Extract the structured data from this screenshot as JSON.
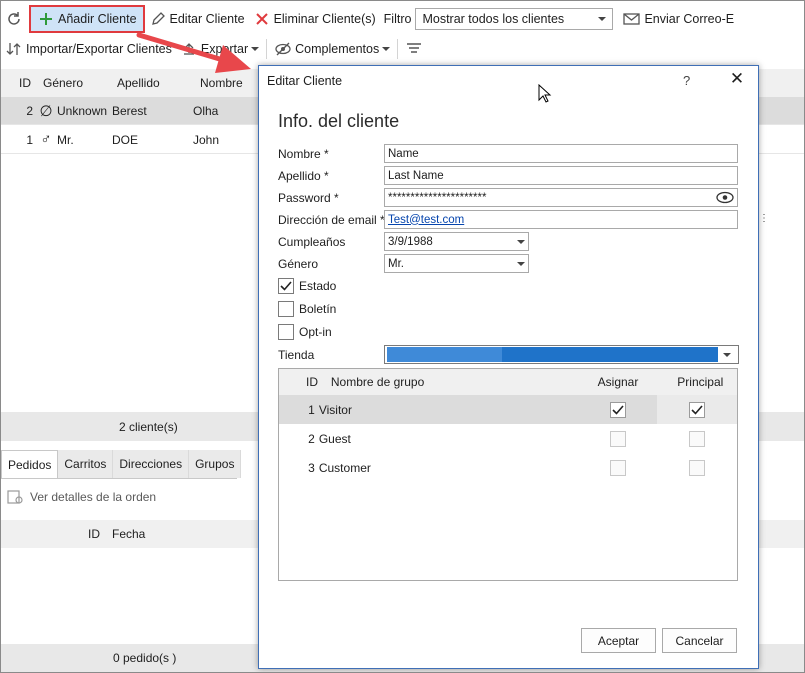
{
  "toolbar1": {
    "add_label": "Añadir Cliente",
    "edit_label": "Editar Cliente",
    "delete_label": "Eliminar Cliente(s)",
    "filter_label": "Filtro",
    "filter_value": "Mostrar todos los clientes",
    "email_label": "Enviar Correo-E"
  },
  "toolbar2": {
    "import_label": "Importar/Exportar Clientes",
    "export_label": "Exportar",
    "addons_label": "Complementos"
  },
  "customers_grid": {
    "columns": [
      "ID",
      "Género",
      "Apellido",
      "Nombre"
    ],
    "rows": [
      {
        "id": "2",
        "gender": "Unknown",
        "last": "Berest",
        "first": "Olha"
      },
      {
        "id": "1",
        "gender": "Mr.",
        "last": "DOE",
        "first": "John"
      }
    ],
    "status": "2 cliente(s)"
  },
  "subtabs": [
    "Pedidos",
    "Carritos",
    "Direcciones",
    "Grupos"
  ],
  "orders": {
    "details_label": "Ver detalles de la orden",
    "columns": [
      "ID",
      "Fecha"
    ],
    "status": "0 pedido(s )"
  },
  "dialog": {
    "title": "Editar Cliente",
    "help": "?",
    "close": "✕",
    "heading": "Info. del cliente",
    "labels": {
      "first_name": "Nombre *",
      "last_name": "Apellido *",
      "password": "Password *",
      "email": "Dirección de email *",
      "birthday": "Cumpleaños",
      "gender": "Género",
      "status": "Estado",
      "newsletter": "Boletín",
      "optin": "Opt-in",
      "shop": "Tienda"
    },
    "values": {
      "first_name": "Name",
      "last_name": "Last Name",
      "password": "**********************",
      "email": "Test@test.com",
      "birthday": "3/9/1988",
      "gender": "Mr."
    },
    "checks": {
      "status": true,
      "newsletter": false,
      "optin": false
    },
    "groups": {
      "columns": [
        "ID",
        "Nombre de grupo",
        "Asignar",
        "Principal"
      ],
      "rows": [
        {
          "id": "1",
          "name": "Visitor",
          "assign": true,
          "main": true
        },
        {
          "id": "2",
          "name": "Guest",
          "assign": false,
          "main": false
        },
        {
          "id": "3",
          "name": "Customer",
          "assign": false,
          "main": false
        }
      ]
    },
    "accept_label": "Aceptar",
    "cancel_label": "Cancelar"
  },
  "colors": {
    "highlight": "#e03a3e",
    "selection": "#cfe3f7",
    "accent": "#1f73c9"
  }
}
